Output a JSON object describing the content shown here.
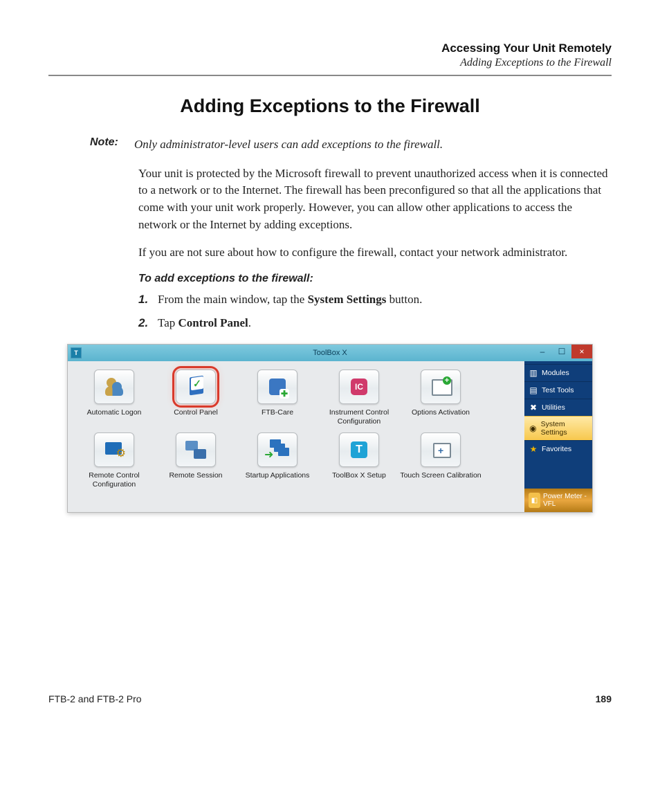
{
  "header": {
    "chapter": "Accessing Your Unit Remotely",
    "section": "Adding Exceptions to the Firewall"
  },
  "title": "Adding Exceptions to the Firewall",
  "note": {
    "label": "Note:",
    "text": "Only administrator-level users can add exceptions to the firewall."
  },
  "paragraphs": [
    "Your unit is protected by the Microsoft firewall to prevent unauthorized access when it is connected to a network or to the Internet. The firewall has been preconfigured so that all the applications that come with your unit work properly. However, you can allow other applications to access the network or the Internet by adding exceptions.",
    "If you are not sure about how to configure the firewall, contact your network administrator."
  ],
  "procedure": {
    "heading": "To add exceptions to the firewall:",
    "steps": [
      {
        "pre": "From the main window, tap the ",
        "bold": "System Settings",
        "post": " button."
      },
      {
        "pre": "Tap ",
        "bold": "Control Panel",
        "post": "."
      }
    ]
  },
  "screenshot": {
    "window_title": "ToolBox X",
    "app_icon_letter": "T",
    "win_controls": {
      "min": "–",
      "max": "☐",
      "close": "×"
    },
    "tiles_row1": [
      {
        "id": "automatic-logon",
        "label": "Automatic Logon"
      },
      {
        "id": "control-panel",
        "label": "Control Panel",
        "selected": true
      },
      {
        "id": "ftb-care",
        "label": "FTB-Care"
      },
      {
        "id": "instrument-control",
        "label": "Instrument Control Configuration"
      },
      {
        "id": "options-activation",
        "label": "Options Activation"
      }
    ],
    "tiles_row2": [
      {
        "id": "remote-control-config",
        "label": "Remote Control Configuration"
      },
      {
        "id": "remote-session",
        "label": "Remote Session"
      },
      {
        "id": "startup-apps",
        "label": "Startup Applications"
      },
      {
        "id": "toolbox-setup",
        "label": "ToolBox X Setup"
      },
      {
        "id": "touch-screen-cal",
        "label": "Touch Screen Calibration"
      }
    ],
    "sidebar": [
      {
        "id": "modules",
        "label": "Modules",
        "icon": "▥"
      },
      {
        "id": "test-tools",
        "label": "Test Tools",
        "icon": "▤"
      },
      {
        "id": "utilities",
        "label": "Utilities",
        "icon": "✖"
      },
      {
        "id": "system-settings",
        "label": "System Settings",
        "icon": "◉",
        "active": true
      },
      {
        "id": "favorites",
        "label": "Favorites",
        "icon": "★"
      }
    ],
    "sidebar_bottom": {
      "label": "Power Meter - VFL",
      "icon": "◧"
    }
  },
  "footer": {
    "product": "FTB-2 and FTB-2 Pro",
    "page": "189"
  }
}
